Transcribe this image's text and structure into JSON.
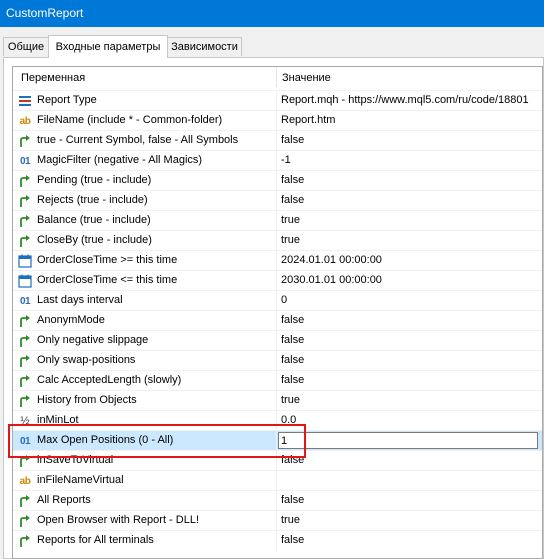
{
  "window": {
    "title": "CustomReport"
  },
  "tabs": [
    {
      "label": "Общие"
    },
    {
      "label": "Входные параметры"
    },
    {
      "label": "Зависимости"
    }
  ],
  "table": {
    "headers": {
      "name": "Переменная",
      "value": "Значение"
    },
    "rows": [
      {
        "icon": "enum-list-icon",
        "name": "Report Type",
        "value": "Report.mqh - https://www.mql5.com/ru/code/18801"
      },
      {
        "icon": "string-ab-icon",
        "name": "FileName (include * - Common-folder)",
        "value": "Report.htm"
      },
      {
        "icon": "bool-arrow-icon",
        "name": "true - Current Symbol, false - All Symbols",
        "value": "false"
      },
      {
        "icon": "int-01-icon",
        "name": "MagicFilter (negative - All Magics)",
        "value": "-1"
      },
      {
        "icon": "bool-arrow-icon",
        "name": "Pending (true - include)",
        "value": "false"
      },
      {
        "icon": "bool-arrow-icon",
        "name": "Rejects (true - include)",
        "value": "false"
      },
      {
        "icon": "bool-arrow-icon",
        "name": "Balance (true - include)",
        "value": "true"
      },
      {
        "icon": "bool-arrow-icon",
        "name": "CloseBy (true - include)",
        "value": "true"
      },
      {
        "icon": "calendar-icon",
        "name": "OrderCloseTime >= this time",
        "value": "2024.01.01 00:00:00"
      },
      {
        "icon": "calendar-icon",
        "name": "OrderCloseTime <= this time",
        "value": "2030.01.01 00:00:00"
      },
      {
        "icon": "int-01-icon",
        "name": "Last days interval",
        "value": "0"
      },
      {
        "icon": "bool-arrow-icon",
        "name": "AnonymMode",
        "value": "false"
      },
      {
        "icon": "bool-arrow-icon",
        "name": "Only negative slippage",
        "value": "false"
      },
      {
        "icon": "bool-arrow-icon",
        "name": "Only swap-positions",
        "value": "false"
      },
      {
        "icon": "bool-arrow-icon",
        "name": "Calc AcceptedLength (slowly)",
        "value": "false"
      },
      {
        "icon": "bool-arrow-icon",
        "name": "History from Objects",
        "value": "true"
      },
      {
        "icon": "double-half-icon",
        "name": "inMinLot",
        "value": "0.0"
      },
      {
        "icon": "int-01-icon",
        "name": "Max Open Positions (0 - All)",
        "value": "1"
      },
      {
        "icon": "bool-arrow-icon",
        "name": "inSaveToVirtual",
        "value": "false"
      },
      {
        "icon": "string-ab-icon",
        "name": "inFileNameVirtual",
        "value": ""
      },
      {
        "icon": "bool-arrow-icon",
        "name": "All Reports",
        "value": "false"
      },
      {
        "icon": "bool-arrow-icon",
        "name": "Open Browser with Report - DLL!",
        "value": "true"
      },
      {
        "icon": "bool-arrow-icon",
        "name": "Reports for All terminals",
        "value": "false"
      }
    ]
  },
  "icon_glyphs": {
    "int-01-icon": "01",
    "string-ab-icon": "ab",
    "double-half-icon": "½"
  },
  "colors": {
    "titlebar": "#0078d7",
    "selection": "#cce8ff",
    "highlight": "#e0161b"
  }
}
